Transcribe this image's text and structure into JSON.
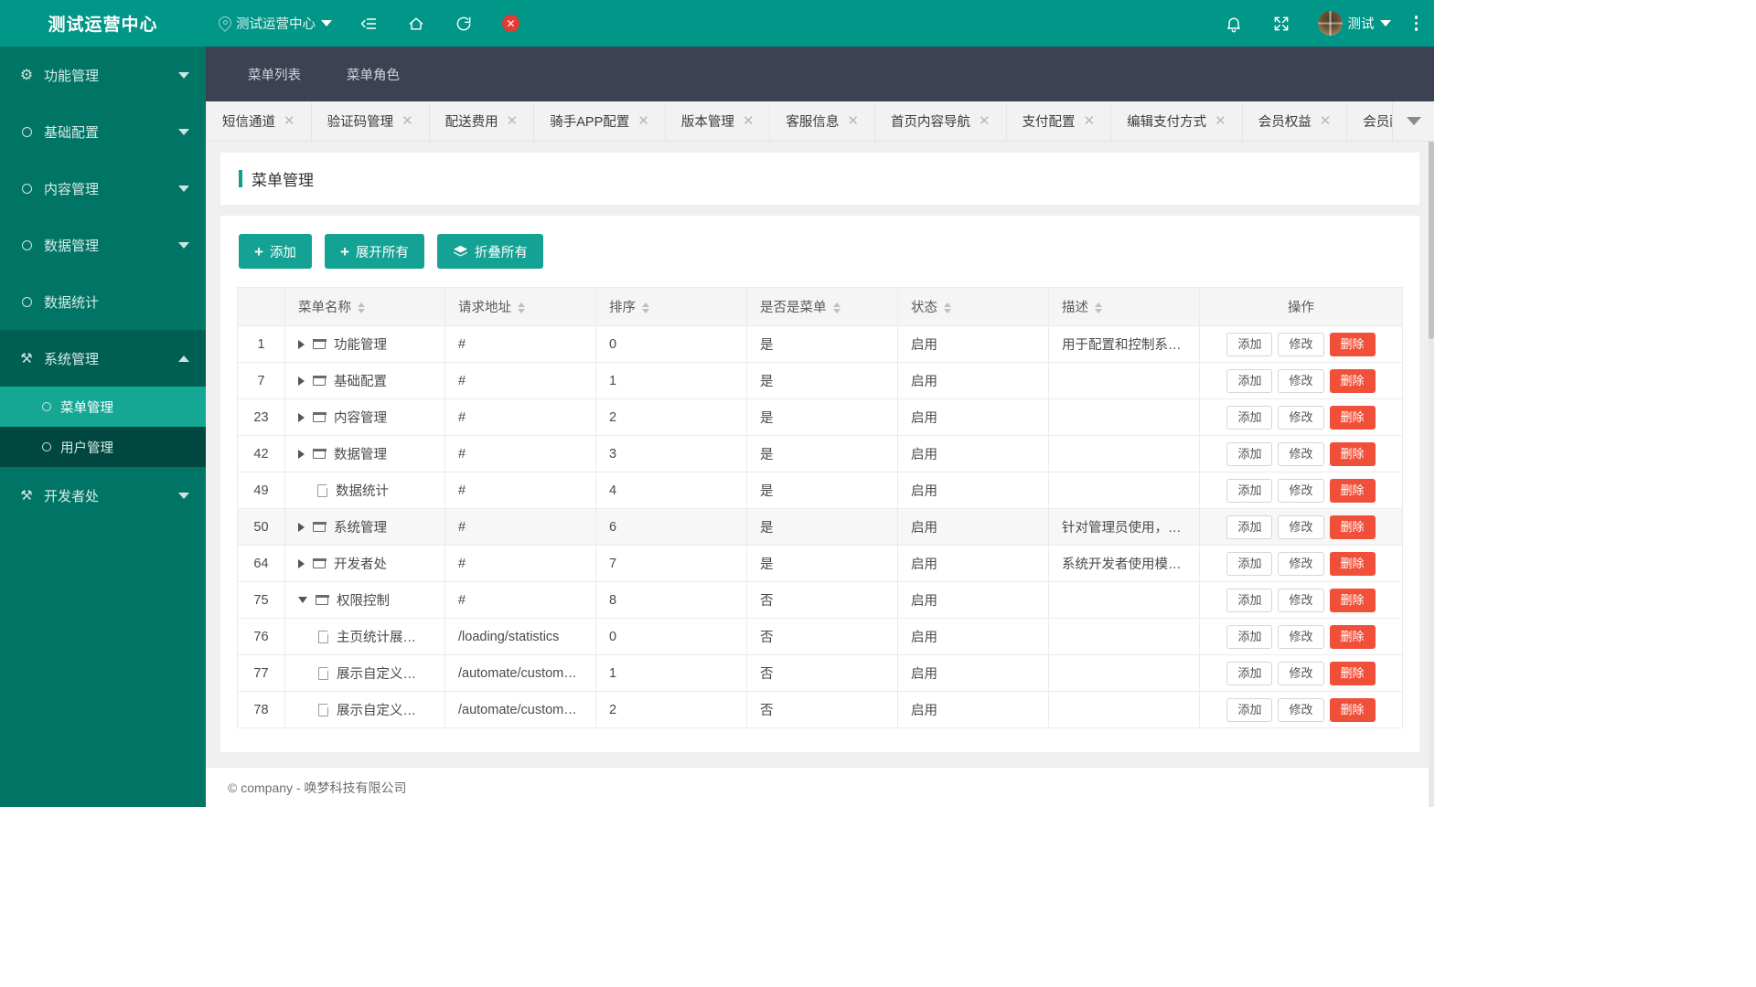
{
  "brand": {
    "title": "测试运营中心"
  },
  "topbar": {
    "location_label": "测试运营中心",
    "icons": {
      "pin": "location-pin-icon",
      "dropdown": "chevron-down-icon",
      "collapse": "collapse-menu-icon",
      "home": "home-icon",
      "refresh": "refresh-icon",
      "close": "close-icon",
      "bell": "bell-icon",
      "fullscreen": "fullscreen-icon",
      "more": "more-vertical-icon"
    },
    "close_glyph": "✕",
    "user_name": "测试"
  },
  "sidebar": {
    "items": [
      {
        "label": "功能管理",
        "icon": "gear-icon",
        "arrow": "down",
        "expanded": false
      },
      {
        "label": "基础配置",
        "icon": "circle-icon",
        "arrow": "down",
        "expanded": false
      },
      {
        "label": "内容管理",
        "icon": "circle-icon",
        "arrow": "down",
        "expanded": false
      },
      {
        "label": "数据管理",
        "icon": "circle-icon",
        "arrow": "down",
        "expanded": false
      },
      {
        "label": "数据统计",
        "icon": "circle-icon",
        "arrow": "none",
        "expanded": false
      },
      {
        "label": "系统管理",
        "icon": "tools-icon",
        "arrow": "up",
        "expanded": true
      },
      {
        "label": "开发者处",
        "icon": "tools-icon",
        "arrow": "down",
        "expanded": false
      }
    ],
    "submenu": [
      {
        "label": "菜单管理",
        "active": true
      },
      {
        "label": "用户管理",
        "active": false
      }
    ]
  },
  "navtabs": [
    {
      "label": "菜单列表"
    },
    {
      "label": "菜单角色"
    }
  ],
  "open_tabs": [
    {
      "label": "短信通道"
    },
    {
      "label": "验证码管理"
    },
    {
      "label": "配送费用"
    },
    {
      "label": "骑手APP配置"
    },
    {
      "label": "版本管理"
    },
    {
      "label": "客服信息"
    },
    {
      "label": "首页内容导航"
    },
    {
      "label": "支付配置"
    },
    {
      "label": "编辑支付方式"
    },
    {
      "label": "会员权益"
    },
    {
      "label": "会员配置"
    }
  ],
  "tab_close_glyph": "✕",
  "page": {
    "title": "菜单管理"
  },
  "toolbar": {
    "add_label": "添加",
    "expand_all_label": "展开所有",
    "collapse_all_label": "折叠所有",
    "plus_glyph": "+"
  },
  "table": {
    "columns": [
      {
        "label": "",
        "sortable": false
      },
      {
        "label": "菜单名称",
        "sortable": true
      },
      {
        "label": "请求地址",
        "sortable": true
      },
      {
        "label": "排序",
        "sortable": true
      },
      {
        "label": "是否是菜单",
        "sortable": true
      },
      {
        "label": "状态",
        "sortable": true
      },
      {
        "label": "描述",
        "sortable": true
      },
      {
        "label": "操作",
        "sortable": false
      }
    ],
    "row_ops": {
      "add": "添加",
      "edit": "修改",
      "delete": "删除"
    },
    "rows": [
      {
        "id": "1",
        "name": "功能管理",
        "toggle": "right",
        "icon": "folder",
        "indent": false,
        "url": "#",
        "order": "0",
        "is_menu": "是",
        "status": "启用",
        "desc": "用于配置和控制系…",
        "shaded": false
      },
      {
        "id": "7",
        "name": "基础配置",
        "toggle": "right",
        "icon": "folder",
        "indent": false,
        "url": "#",
        "order": "1",
        "is_menu": "是",
        "status": "启用",
        "desc": "",
        "shaded": false
      },
      {
        "id": "23",
        "name": "内容管理",
        "toggle": "right",
        "icon": "folder",
        "indent": false,
        "url": "#",
        "order": "2",
        "is_menu": "是",
        "status": "启用",
        "desc": "",
        "shaded": false
      },
      {
        "id": "42",
        "name": "数据管理",
        "toggle": "right",
        "icon": "folder",
        "indent": false,
        "url": "#",
        "order": "3",
        "is_menu": "是",
        "status": "启用",
        "desc": "",
        "shaded": false
      },
      {
        "id": "49",
        "name": "数据统计",
        "toggle": "none",
        "icon": "file",
        "indent": false,
        "url": "#",
        "order": "4",
        "is_menu": "是",
        "status": "启用",
        "desc": "",
        "shaded": false
      },
      {
        "id": "50",
        "name": "系统管理",
        "toggle": "right",
        "icon": "folder",
        "indent": false,
        "url": "#",
        "order": "6",
        "is_menu": "是",
        "status": "启用",
        "desc": "针对管理员使用，…",
        "shaded": true
      },
      {
        "id": "64",
        "name": "开发者处",
        "toggle": "right",
        "icon": "folder",
        "indent": false,
        "url": "#",
        "order": "7",
        "is_menu": "是",
        "status": "启用",
        "desc": "系统开发者使用模…",
        "shaded": false
      },
      {
        "id": "75",
        "name": "权限控制",
        "toggle": "down",
        "icon": "folder",
        "indent": false,
        "url": "#",
        "order": "8",
        "is_menu": "否",
        "status": "启用",
        "desc": "",
        "shaded": false
      },
      {
        "id": "76",
        "name": "主页统计展…",
        "toggle": "none",
        "icon": "file",
        "indent": true,
        "url": "/loading/statistics",
        "order": "0",
        "is_menu": "否",
        "status": "启用",
        "desc": "",
        "shaded": false
      },
      {
        "id": "77",
        "name": "展示自定义…",
        "toggle": "none",
        "icon": "file",
        "indent": true,
        "url": "/automate/custom…",
        "order": "1",
        "is_menu": "否",
        "status": "启用",
        "desc": "",
        "shaded": false
      },
      {
        "id": "78",
        "name": "展示自定义…",
        "toggle": "none",
        "icon": "file",
        "indent": true,
        "url": "/automate/custom…",
        "order": "2",
        "is_menu": "否",
        "status": "启用",
        "desc": "",
        "shaded": false
      }
    ]
  },
  "footer": {
    "text": "© company - 唤梦科技有限公司"
  },
  "colors": {
    "primary": "#009688",
    "sidebar": "#007566",
    "sidebar_submenu": "#00483f",
    "sidebar_active": "#13a794",
    "navbar": "#3c4252",
    "danger": "#f0503a",
    "button": "#13a294"
  }
}
